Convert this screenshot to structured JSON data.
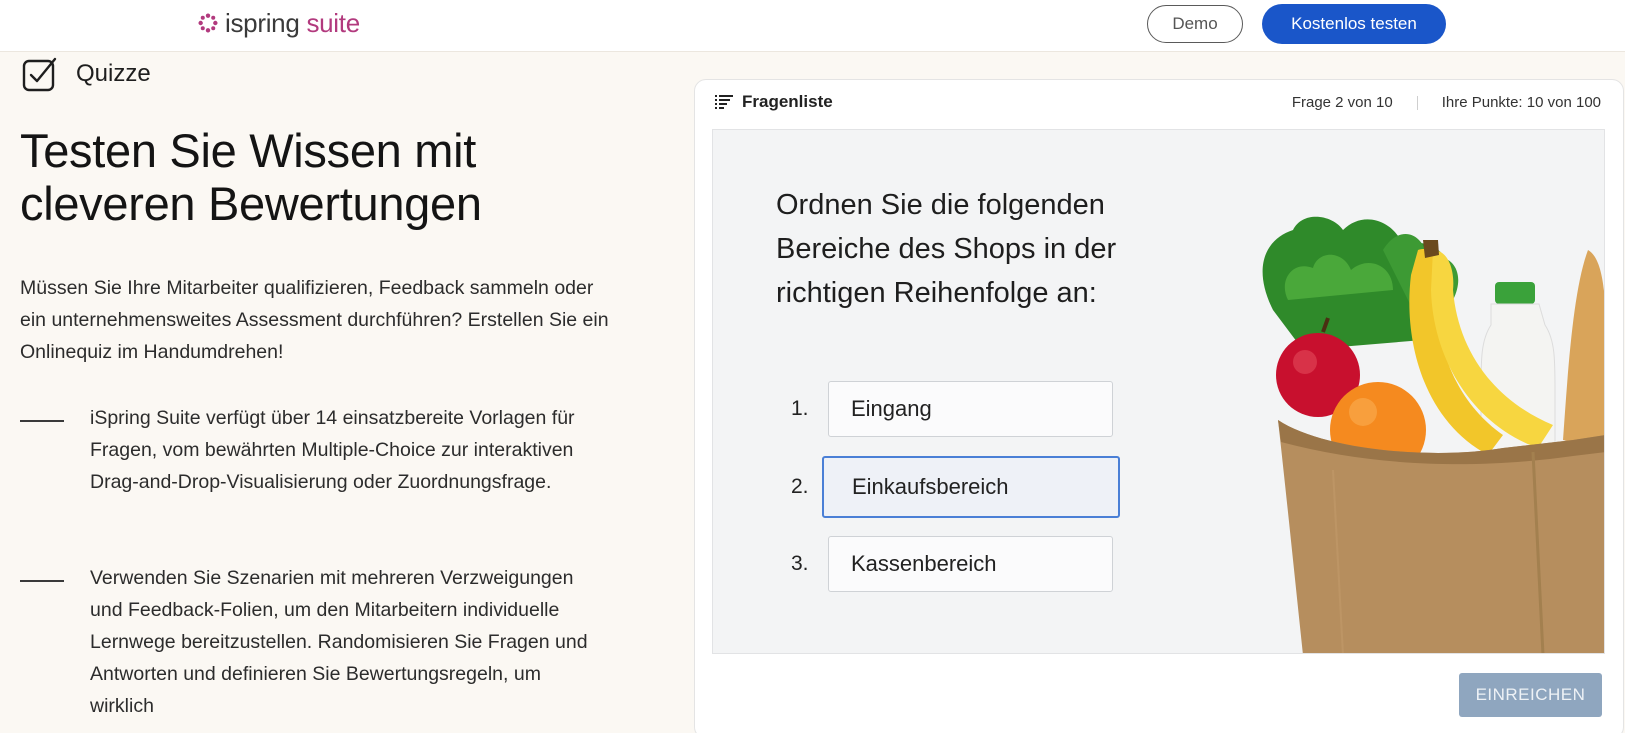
{
  "header": {
    "logo_word1": "ispring",
    "logo_word2": "suite",
    "demo_label": "Demo",
    "try_label": "Kostenlos testen",
    "brand_color": "#b23a7e",
    "accent_color": "#1a56c9"
  },
  "section": {
    "icon": "checkbox-checked-icon",
    "label": "Quizze"
  },
  "main": {
    "headline_line1": "Testen Sie Wissen mit",
    "headline_line2": "cleveren Bewertungen",
    "intro": "Müssen Sie Ihre Mitarbeiter qualifizieren, Feedback sammeln oder ein unternehmensweites Assessment durchführen? Erstellen Sie ein Onlinequiz im Handumdrehen!",
    "features": [
      {
        "text": "iSpring Suite verfügt über 14 einsatzbereite Vorlagen für Fragen, vom bewährten Multiple-Choice zur interaktiven Drag-and-Drop-Visualisierung oder Zuordnungsfrage."
      },
      {
        "text": "Verwenden Sie Szenarien mit mehreren Verzweigungen und Feedback-Folien, um den Mitarbeitern individuelle Lernwege bereitzustellen. Randomisieren Sie Fragen und Antworten und definieren Sie Bewertungsregeln, um wirklich"
      }
    ]
  },
  "quiz": {
    "list_icon": "list-icon",
    "list_label": "Fragenliste",
    "question_progress": "Frage 2 von 10",
    "score": "Ihre Punkte: 10 von 100",
    "question": "Ordnen Sie die folgenden Bereiche des Shops in der richtigen Reihenfolge an:",
    "options": [
      {
        "num": "1.",
        "label": "Eingang"
      },
      {
        "num": "2.",
        "label": "Einkaufsbereich"
      },
      {
        "num": "3.",
        "label": "Kassenbereich"
      }
    ],
    "image_icon": "grocery-bag-image",
    "submit_label": "EINREICHEN"
  }
}
